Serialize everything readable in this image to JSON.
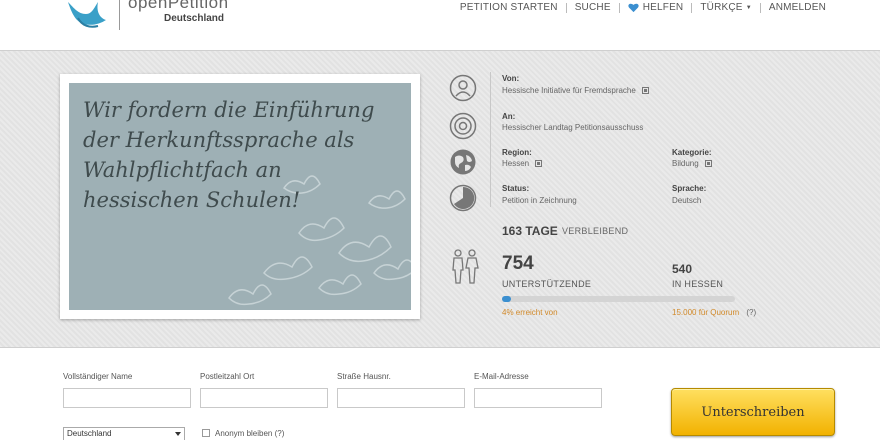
{
  "header": {
    "logo_text": "openPetition",
    "logo_sub": "Deutschland",
    "nav": {
      "start": "PETITION STARTEN",
      "search": "SUCHE",
      "help": "HELFEN",
      "language": "TÜRKÇE",
      "login": "ANMELDEN"
    }
  },
  "petition": {
    "title": "Wir fordern die Einführung der Herkunftssprache als Wahlpflichtfach an hessischen Schulen!",
    "from_label": "Von:",
    "from_value": "Hessische Initiative für Fremdsprache",
    "to_label": "An:",
    "to_value": "Hessischer Landtag Petitionsausschuss",
    "region_label": "Region:",
    "region_value": "Hessen",
    "category_label": "Kategorie:",
    "category_value": "Bildung",
    "status_label": "Status:",
    "status_value": "Petition in Zeichnung",
    "language_label": "Sprache:",
    "language_value": "Deutsch",
    "days_count": "163 TAGE",
    "days_label": "VERBLEIBEND",
    "supporters_count": "754",
    "supporters_label": "UNTERSTÜTZENDE",
    "hessen_count": "540",
    "hessen_label": "IN HESSEN",
    "progress_percent": 4,
    "reached_text": "4% erreicht von",
    "quorum_text": "15.000  für Quorum",
    "quorum_help": "(?)"
  },
  "form": {
    "name_label": "Vollständiger Name",
    "postal_label": "Postleitzahl Ort",
    "street_label": "Straße Hausnr.",
    "email_label": "E-Mail-Adresse",
    "country_value": "Deutschland",
    "anonymous_label": "Anonym bleiben (?)",
    "submit_label": "Unterschreiben"
  },
  "colors": {
    "accent_blue": "#3b8fd0",
    "quorum_orange": "#d28a2a",
    "submit_yellow": "#f2b200",
    "poster_bg": "#9eb0b5"
  }
}
